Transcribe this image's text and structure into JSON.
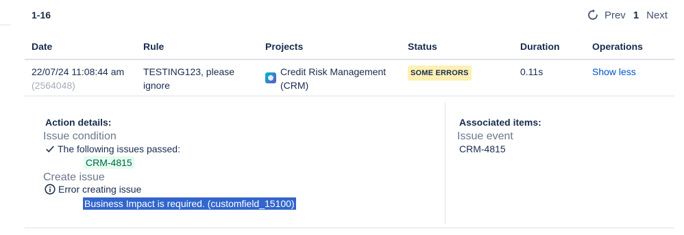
{
  "pagination": {
    "range": "1-16",
    "refresh_icon": "refresh-icon",
    "prev": "Prev",
    "current_page": "1",
    "next": "Next"
  },
  "table": {
    "columns": [
      "Date",
      "Rule",
      "Projects",
      "Status",
      "Duration",
      "Operations"
    ],
    "row": {
      "date": "22/07/24 11:08:44 am",
      "id": "(2564048)",
      "rule_line1": "TESTING123, please",
      "rule_line2": "ignore",
      "project_line1": "Credit Risk Management",
      "project_line2": "(CRM)",
      "status": "SOME ERRORS",
      "duration": "0.11s",
      "operation": "Show less"
    }
  },
  "details": {
    "action_title": "Action details:",
    "issue_condition": "Issue condition",
    "passed_text": "The following issues passed:",
    "passed_issue": "CRM-4815",
    "create_issue": "Create issue",
    "error_text": "Error creating issue",
    "error_detail": "Business Impact is required. (customfield_15100)",
    "associated_title": "Associated items:",
    "issue_event": "Issue event",
    "associated_issue": "CRM-4815"
  },
  "colors": {
    "link": "#0052cc",
    "status_bg": "#fff0b3",
    "passed_chip_bg": "#e3fcef",
    "selection_bg": "#3366cc"
  }
}
